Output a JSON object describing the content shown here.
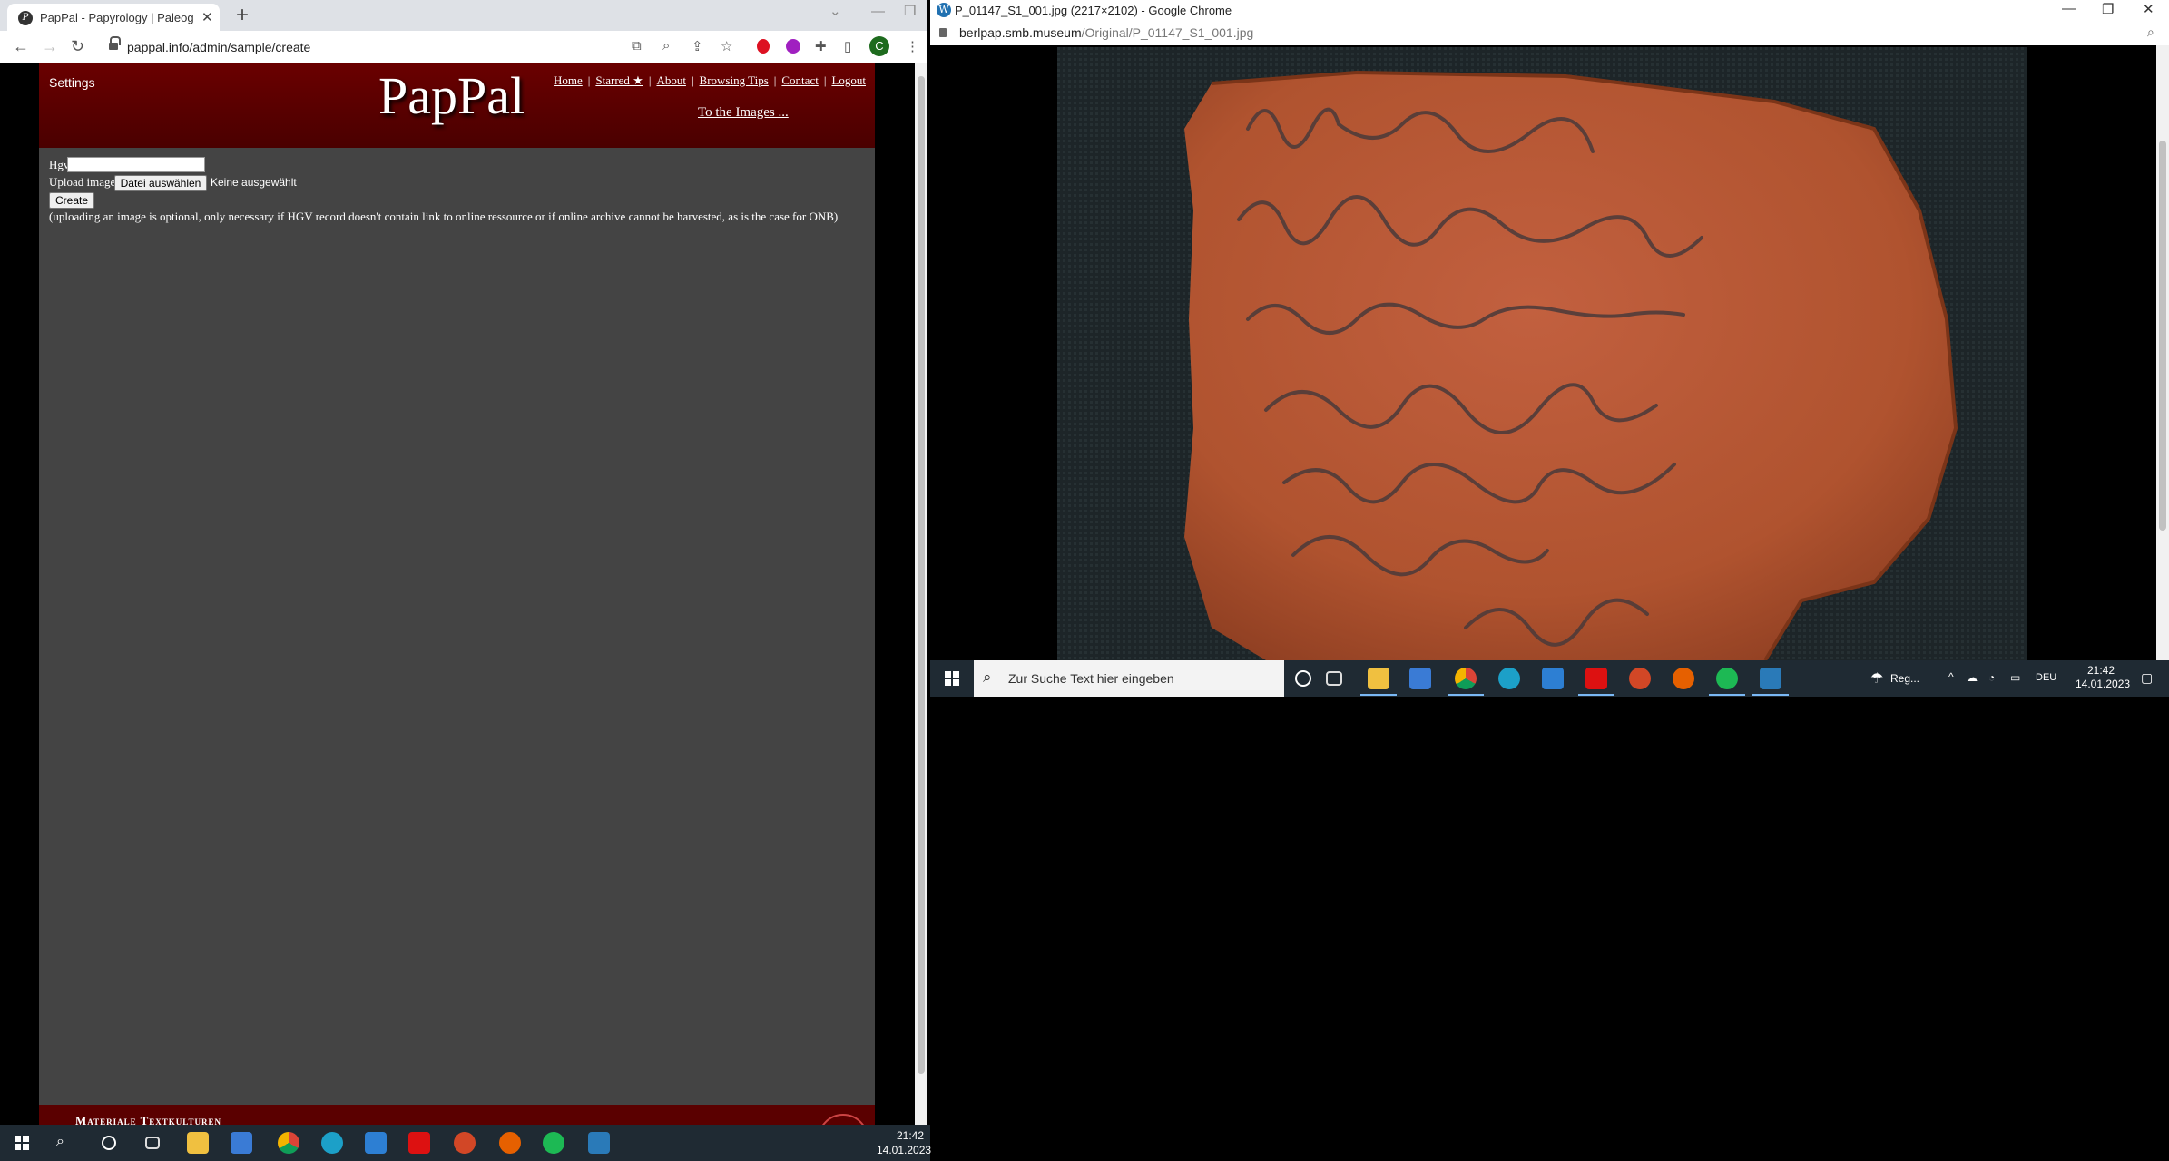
{
  "left_browser": {
    "tab_title": "PapPal - Papyrology | Paleograph",
    "url": "pappal.info/admin/sample/create",
    "profile_initial": "C"
  },
  "pappal": {
    "settings": "Settings",
    "logo": "PapPal",
    "nav": [
      "Home",
      "Starred ★",
      "About",
      "Browsing Tips",
      "Contact",
      "Logout"
    ],
    "to_images": "To the Images ...",
    "form": {
      "hgv_label": "Hgv",
      "hgv_value": "",
      "upload_label": "Upload image",
      "file_button": "Datei auswählen",
      "file_status": "Keine ausgewählt",
      "create_button": "Create",
      "note": "(uploading an image is optional, only necessary if HGV record doesn't contain link to online ressource or if online archive cannot be harvested, as is the case for ONB)"
    },
    "footer_text": "Materiale Textkulturen"
  },
  "right_browser": {
    "window_title": "P_01147_S1_001.jpg (2217×2102) - Google Chrome",
    "url_host": "berlpap.smb.museum",
    "url_path": "/Original/P_01147_S1_001.jpg"
  },
  "right_taskbar": {
    "search_placeholder": "Zur Suche Text hier eingeben",
    "weather": "Reg...",
    "language": "DEU",
    "time": "21:42",
    "date": "14.01.2023"
  },
  "left_taskbar": {
    "time": "21:42",
    "date": "14.01.2023"
  },
  "colors": {
    "header_red": "#6a0000",
    "page_gray": "#444444",
    "sherd": "#b8573a"
  }
}
